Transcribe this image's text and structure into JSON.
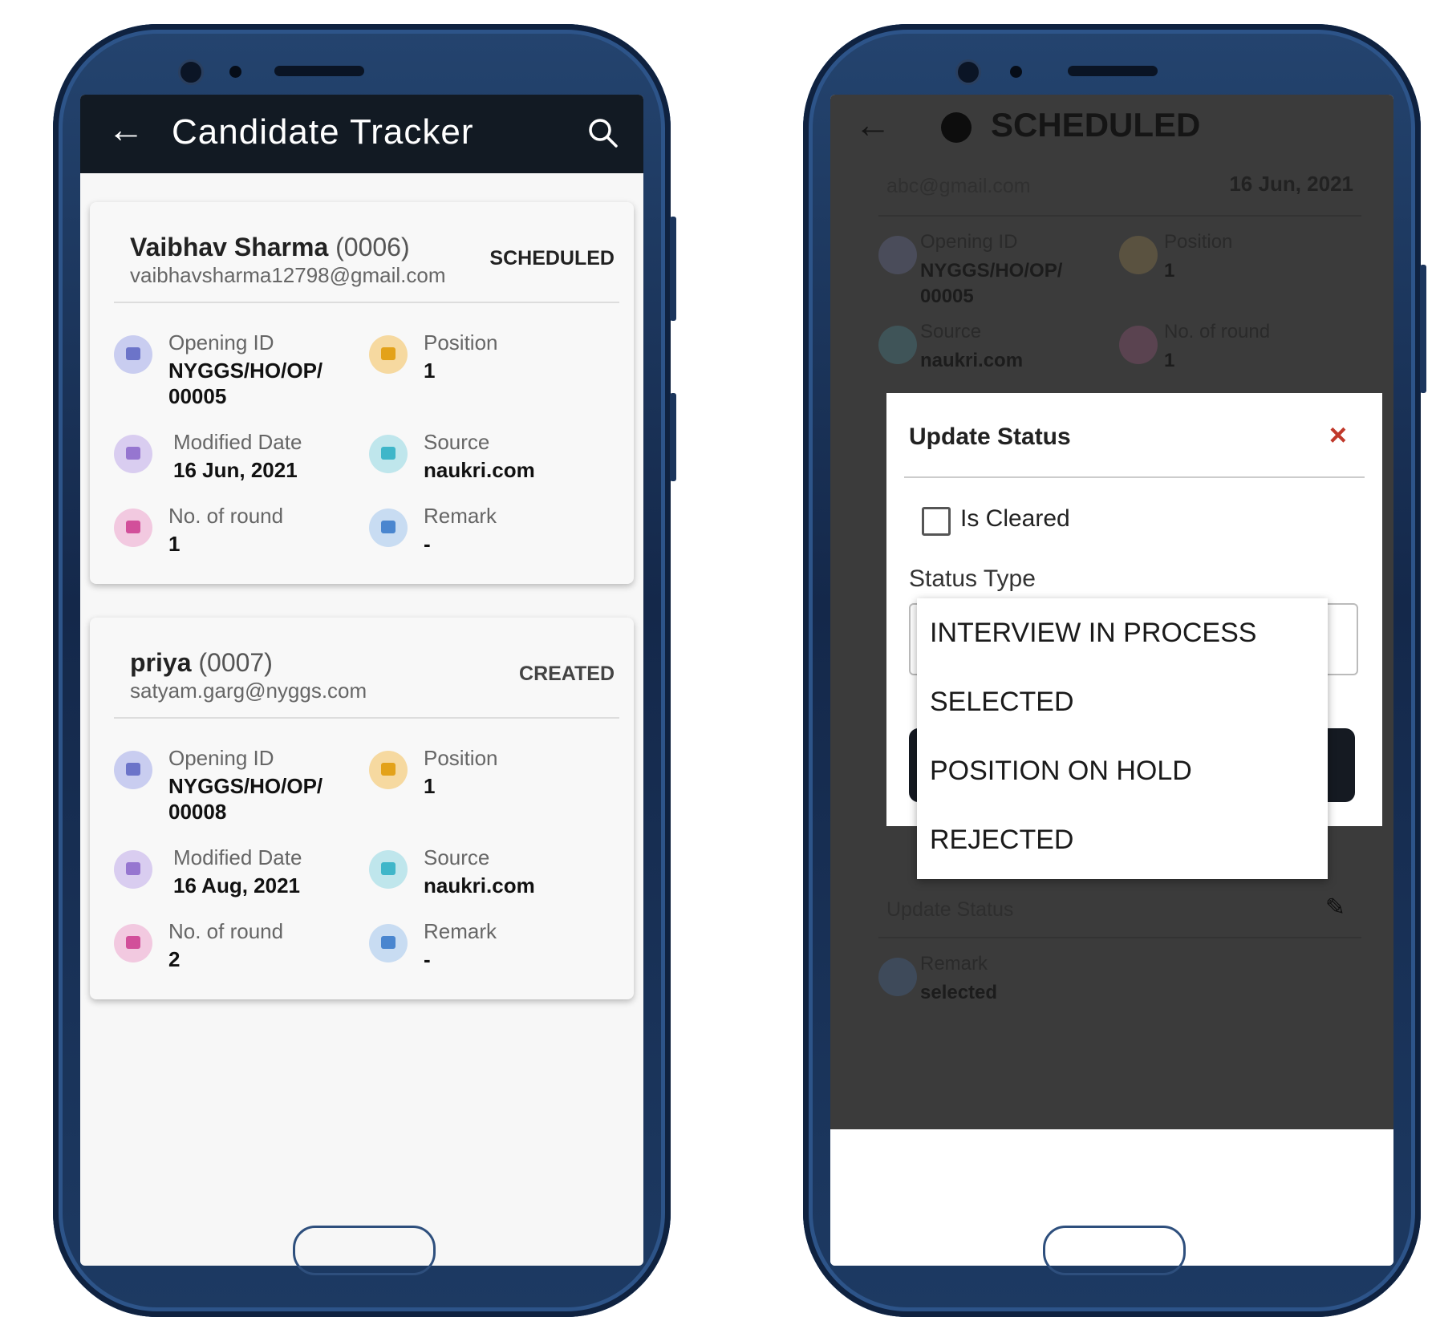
{
  "left": {
    "appbar": {
      "title": "Candidate Tracker",
      "back_icon": "arrow-left-icon",
      "search_icon": "search-icon"
    },
    "cards": [
      {
        "name": "Vaibhav Sharma",
        "id": "(0006)",
        "email": "vaibhavsharma12798@gmail.com",
        "status": "SCHEDULED",
        "opening_id_label": "Opening ID",
        "opening_id_value": "NYGGS/HO/OP/\n00005",
        "position_label": "Position",
        "position_value": "1",
        "modified_label": "Modified Date",
        "modified_value": "16 Jun, 2021",
        "source_label": "Source",
        "source_value": "naukri.com",
        "rounds_label": "No. of round",
        "rounds_value": "1",
        "remark_label": "Remark",
        "remark_value": "-"
      },
      {
        "name": "priya",
        "id": "(0007)",
        "email": "satyam.garg@nyggs.com",
        "status": "CREATED",
        "opening_id_label": "Opening ID",
        "opening_id_value": "NYGGS/HO/OP/\n00008",
        "position_label": "Position",
        "position_value": "1",
        "modified_label": "Modified Date",
        "modified_value": "16 Aug, 2021",
        "source_label": "Source",
        "source_value": "naukri.com",
        "rounds_label": "No. of round",
        "rounds_value": "2",
        "remark_label": "Remark",
        "remark_value": "-"
      }
    ]
  },
  "right": {
    "header": {
      "title": "SCHEDULED",
      "email": "abc@gmail.com",
      "date": "16 Jun, 2021"
    },
    "background_fields": {
      "opening_id_label": "Opening ID",
      "opening_id_value": "NYGGS/HO/OP/\n00005",
      "position_label": "Position",
      "position_value": "1",
      "source_label": "Source",
      "source_value": "naukri.com",
      "rounds_label": "No. of round",
      "rounds_value": "1",
      "update_status_label": "Update Status",
      "remark_label": "Remark",
      "remark_value": "selected"
    },
    "dialog": {
      "title": "Update Status",
      "close": "×",
      "checkbox_label": "Is Cleared",
      "status_type_label": "Status Type",
      "options": [
        "INTERVIEW IN PROCESS",
        "SELECTED",
        "POSITION ON HOLD",
        "REJECTED"
      ]
    }
  },
  "colors": {
    "appbar": "#121a23",
    "phone_frame": "#1d3a63",
    "icon_opening": "#c9cdf0",
    "icon_position": "#f6d9a0",
    "icon_modified": "#d9cdf0",
    "icon_source": "#bfe6ec",
    "icon_rounds": "#f2c9e0",
    "icon_remark": "#c8dcf2",
    "close": "#c0392b"
  }
}
